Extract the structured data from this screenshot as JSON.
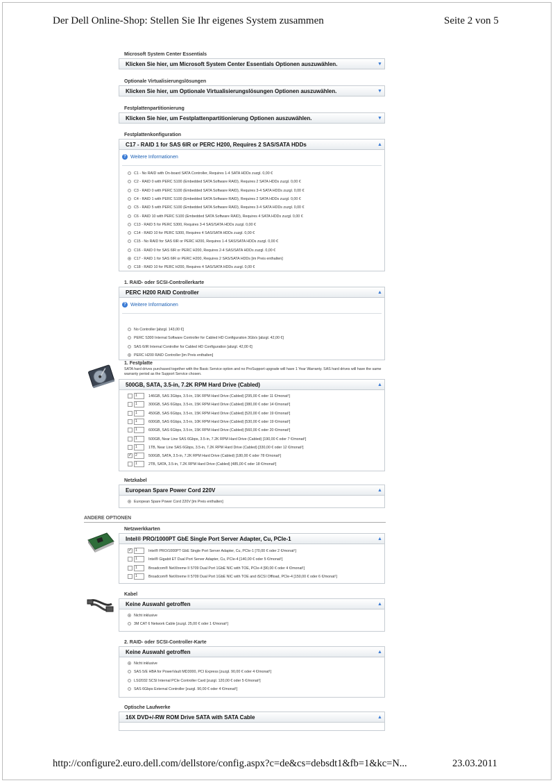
{
  "header": {
    "title": "Der Dell Online-Shop: Stellen Sie Ihr eigenes System zusammen",
    "page": "Seite 2 von 5"
  },
  "footer": {
    "url": "http://configure2.euro.dell.com/dellstore/config.aspx?c=de&cs=debsdt1&fb=1&kc=N...",
    "date": "23.03.2011"
  },
  "colors": {
    "accent": "#3a7bd5",
    "link": "#1a5fb4",
    "border": "#c6ccd2"
  },
  "sections": {
    "sce": {
      "label": "Microsoft System Center Essentials",
      "value": "Klicken Sie hier, um Microsoft System Center Essentials Optionen auszuwählen."
    },
    "virt": {
      "label": "Optionale Virtualisierungslösungen",
      "value": "Klicken Sie hier, um Optionale Virtualisierungslösungen Optionen auszuwählen."
    },
    "part": {
      "label": "Festplattenpartitionierung",
      "value": "Klicken Sie hier, um Festplattenpartitionierung Optionen auszuwählen."
    },
    "raid_config": {
      "label": "Festplattenkonfiguration",
      "value": "C17 - RAID 1 for SAS 6IR or PERC H200, Requires 2 SAS/SATA HDDs",
      "info": "Weitere Informationen",
      "options": [
        "C1 - No RAID with On-board SATA Controller, Requires 1-4 SATA HDDs zuzgl. 0,00 €",
        "C2 - RAID 0 with PERC S100 (Embedded SATA Software RAID), Requires 2 SATA HDDs zuzgl. 0,00 €",
        "C3 - RAID 0 with PERC S100 (Embedded SATA Software RAID), Requires 3-4 SATA HDDs zuzgl. 0,00 €",
        "C4 - RAID 1 with PERC S100 (Embedded SATA Software RAID), Requires 2 SATA HDDs zuzgl. 0,00 €",
        "C5 - RAID 5 with PERC S100 (Embedded SATA Software RAID), Requires 3-4 SATA HDDs zuzgl. 0,00 €",
        "C6 - RAID 10 with PERC S100 (Embedded SATA Software RAID), Requires 4 SATA HDDs zuzgl. 0,00 €",
        "C13 - RAID 5 for PERC S300, Requires 3-4 SAS/SATA HDDs zuzgl. 0,00 €",
        "C14 - RAID 10 for PERC S300, Requires 4 SAS/SATA HDDs zuzgl. 0,00 €",
        "C15 - No RAID for SAS 6IR or PERC H200, Requires 1-4 SAS/SATA HDDs zuzgl. 0,00 €",
        "C16 - RAID 0 for SAS 6IR or PERC H200, Requires 2-4 SAS/SATA HDDs zuzgl. 0,00 €",
        "C17 - RAID 1 for SAS 6IR or PERC H200, Requires 2 SAS/SATA HDDs [im Preis enthalten]",
        "C18 - RAID 10 for PERC H200, Requires 4 SAS/SATA HDDs zuzgl. 0,00 €"
      ],
      "selected": 10
    },
    "raid_ctrl": {
      "label": "1. RAID- oder SCSI-Controllerkarte",
      "value": "PERC H200 RAID Controller",
      "info": "Weitere Informationen",
      "options": [
        "No Controller [abzgl. 143,00 €]",
        "PERC S300 Internal Software Controller for Cabled HD Configuration 3Gb/s [abzgl. 42,00 €]",
        "SAS 6/iR Internal Controller for Cabled HD Configuration [abzgl. 42,00 €]",
        "PERC H200 RAID Controller [im Preis enthalten]"
      ],
      "selected": 3
    },
    "disk": {
      "label": "1. Festplatte",
      "note": "SATA hard drives purchased together with the Basic Service option and no ProSupport upgrade will have 1 Year Warranty. SAS hard drives will have the same warranty period as the Support Service chosen.",
      "value": "500GB, SATA, 3.5-in, 7.2K RPM Hard Drive (Cabled)",
      "image": "hard-drive-image",
      "options": [
        {
          "qty": "1",
          "checked": false,
          "text": "146GB, SAS 3Gbps, 3.5-in, 15K RPM Hard Drive (Cabled) [295,00 € oder 11 €/monat¹]"
        },
        {
          "qty": "1",
          "checked": false,
          "text": "300GB, SAS 6Gbps, 3.5-in, 15K RPM Hard Drive (Cabled) [380,00 € oder 14 €/monat¹]"
        },
        {
          "qty": "1",
          "checked": false,
          "text": "450GB, SAS 6Gbps, 3.5-in, 15K RPM Hard Drive (Cabled) [520,00 € oder 19 €/monat¹]"
        },
        {
          "qty": "1",
          "checked": false,
          "text": "600GB, SAS 6Gbps, 3.5-in, 10K RPM Hard Drive (Cabled) [530,00 € oder 19 €/monat¹]"
        },
        {
          "qty": "1",
          "checked": false,
          "text": "600GB, SAS 6Gbps, 3.5-in, 15K RPM Hard Drive (Cabled) [560,00 € oder 20 €/monat¹]"
        },
        {
          "qty": "1",
          "checked": false,
          "text": "500GB, Near Line SAS 6Gbps, 3.5-in, 7.2K RPM Hard Drive (Cabled) [190,00 € oder 7 €/monat¹]"
        },
        {
          "qty": "1",
          "checked": false,
          "text": "1TB, Near Line SAS 6Gbps, 3.5-in, 7.2K RPM Hard Drive (Cabled) [330,00 € oder 12 €/monat¹]"
        },
        {
          "qty": "2",
          "checked": true,
          "text": "500GB, SATA, 3.5-in, 7.2K RPM Hard Drive (Cabled) [180,00 € oder 78 €/monat¹]"
        },
        {
          "qty": "1",
          "checked": false,
          "text": "2TB, SATA, 3.5-in, 7.2K RPM Hard Drive (Cabled) [485,00 € oder 18 €/monat¹]"
        }
      ]
    },
    "power": {
      "label": "Netzkabel",
      "value": "European Spare Power Cord 220V",
      "options": [
        "European Spare Power Cord 220V [im Preis enthalten]"
      ],
      "selected": 0
    },
    "other_title": "ANDERE OPTIONEN",
    "nic": {
      "label": "Netzwerkkarten",
      "value": "Intel® PRO/1000PT GbE Single Port Server Adapter, Cu, PCIe-1",
      "image": "network-card-image",
      "options": [
        {
          "qty": "1",
          "checked": true,
          "text": "Intel® PRO/1000PT GbE Single Port Server Adapter, Cu, PCIe-1 [70,00 € oder 2 €/monat¹]"
        },
        {
          "qty": "1",
          "checked": false,
          "text": "Intel® Gigabit ET Dual Port Server Adapter, Cu, PCIe-4 [140,00 € oder 5 €/monat¹]"
        },
        {
          "qty": "1",
          "checked": false,
          "text": "Broadcom® NetXtreme II 5709 Dual Port 1GbE NIC with TOE, PCIe-4 [90,00 € oder 4 €/monat¹]"
        },
        {
          "qty": "1",
          "checked": false,
          "text": "Broadcom® NetXtreme II 5709 Dual Port 1GbE NIC with TOE and iSCSI Offload, PCIe-4 [150,00 € oder 6 €/monat¹]"
        }
      ]
    },
    "cable": {
      "label": "Kabel",
      "value": "Keine Auswahl getroffen",
      "image": "network-cable-image",
      "options": [
        "Nicht inklusive",
        "3M CAT 6 Network Cable [zuzgl. 25,00 € oder 1 €/monat¹]"
      ],
      "selected": 0
    },
    "raid2": {
      "label": "2. RAID- oder SCSI-Controller-Karte",
      "value": "Keine Auswahl getroffen",
      "options": [
        "Nicht inklusive",
        "SAS 5/E HBA for PowerVault MD3000, PCI Express [zuzgl. 90,00 € oder 4 €/monat¹]",
        "LSI2032 SCSI Internal PCIe Controller Card [zuzgl. 120,00 € oder 5 €/monat¹]",
        "SAS 6Gbps External Controller [zuzgl. 90,00 € oder 4 €/monat¹]"
      ],
      "selected": 0
    },
    "optical": {
      "label": "Optische Laufwerke",
      "value": "16X DVD+/-RW ROM Drive SATA with SATA Cable"
    }
  }
}
